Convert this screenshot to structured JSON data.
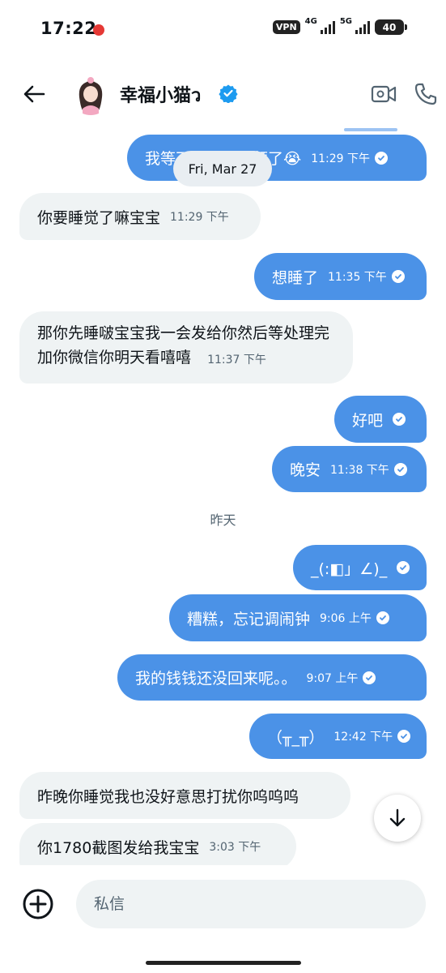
{
  "status_bar": {
    "time": "17:22",
    "vpn": "VPN",
    "net1": "4G",
    "net2": "5G",
    "battery": "40"
  },
  "header": {
    "contact_name": "幸福小猫ว",
    "icons": {
      "back": "arrow-left-icon",
      "verified": "verified-badge-icon",
      "video": "video-camera-icon",
      "call": "phone-icon"
    }
  },
  "messages": [
    {
      "dir": "out",
      "text": "我等不到你的视频了😭",
      "time": "11:29 下午",
      "status": "sent"
    },
    {
      "dir": "in",
      "text": "你要睡觉了嘛宝宝",
      "time": "11:29 下午"
    },
    {
      "dir": "out",
      "text": "想睡了",
      "time": "11:35 下午",
      "status": "sent"
    },
    {
      "dir": "in",
      "text": "那你先睡啵宝宝我一会发给你然后等处理完加你微信你明天看嘻嘻",
      "time": "11:37 下午"
    },
    {
      "dir": "out",
      "text": "好吧",
      "time": "",
      "status": "sent"
    },
    {
      "dir": "out",
      "text": "晚安",
      "time": "11:38 下午",
      "status": "sent"
    },
    {
      "dir": "out",
      "text": "_(:◧」∠)_",
      "time": "",
      "status": "sent"
    },
    {
      "dir": "out",
      "text": "糟糕，忘记调闹钟",
      "time": "9:06 上午",
      "status": "sent"
    },
    {
      "dir": "out",
      "text": "我的钱钱还没回来呢。。",
      "time": "9:07 上午",
      "status": "sent"
    },
    {
      "dir": "out",
      "text": "（╥_╥）",
      "time": "12:42 下午",
      "status": "sent"
    },
    {
      "dir": "in",
      "text": "昨晚你睡觉我也没好意思打扰你呜呜呜",
      "time": ""
    },
    {
      "dir": "in",
      "text": "你1780截图发给我宝宝",
      "time": "3:03 下午"
    }
  ],
  "date_separator": "Fri, Mar 27",
  "day_label": "昨天",
  "composer": {
    "placeholder": "私信",
    "icons": {
      "add": "add-circle-icon",
      "scroll": "arrow-down-icon"
    }
  },
  "colors": {
    "outgoing": "#4b92e7",
    "incoming": "#eff3f4",
    "verified": "#1d9bf0"
  }
}
